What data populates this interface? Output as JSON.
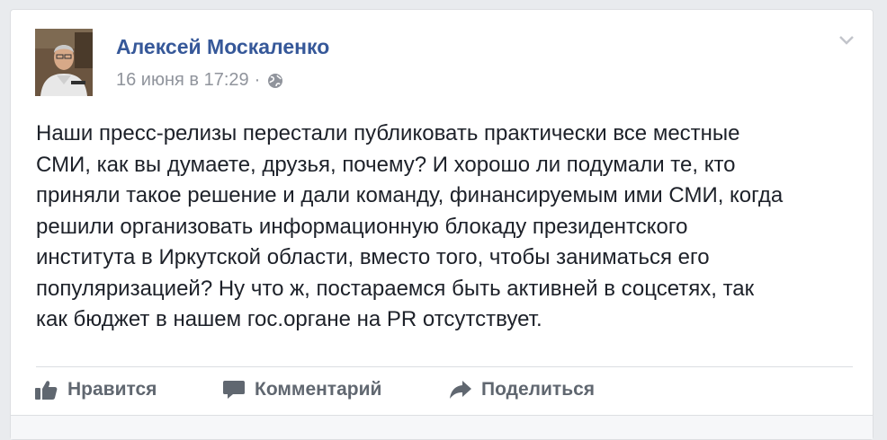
{
  "post": {
    "author": "Алексей Москаленко",
    "date": "16 июня в 17:29",
    "separator": "·",
    "privacy_icon": "globe-icon",
    "menu_icon": "chevron-down-icon",
    "text": "Наши пресс-релизы перестали публиковать практически все местные\nСМИ, как вы думаете, друзья, почему? И хорошо ли подумали те, кто\nприняли такое решение и дали команду, финансируемым ими СМИ, когда\nрешили организовать информационную блокаду президентского\nинститута в Иркутской области, вместо того, чтобы заниматься его\nпопуляризацией? Ну что ж, постараемся быть активней в соцсетях, так\nкак бюджет в нашем гос.органе на PR отсутствует."
  },
  "actions": {
    "like": {
      "label": "Нравится",
      "icon": "thumbs-up-icon"
    },
    "comment": {
      "label": "Комментарий",
      "icon": "comment-icon"
    },
    "share": {
      "label": "Поделиться",
      "icon": "share-icon"
    }
  },
  "colors": {
    "author": "#365899",
    "meta": "#90949c",
    "text": "#1d2129",
    "action": "#606770",
    "background": "#e9ebee"
  }
}
